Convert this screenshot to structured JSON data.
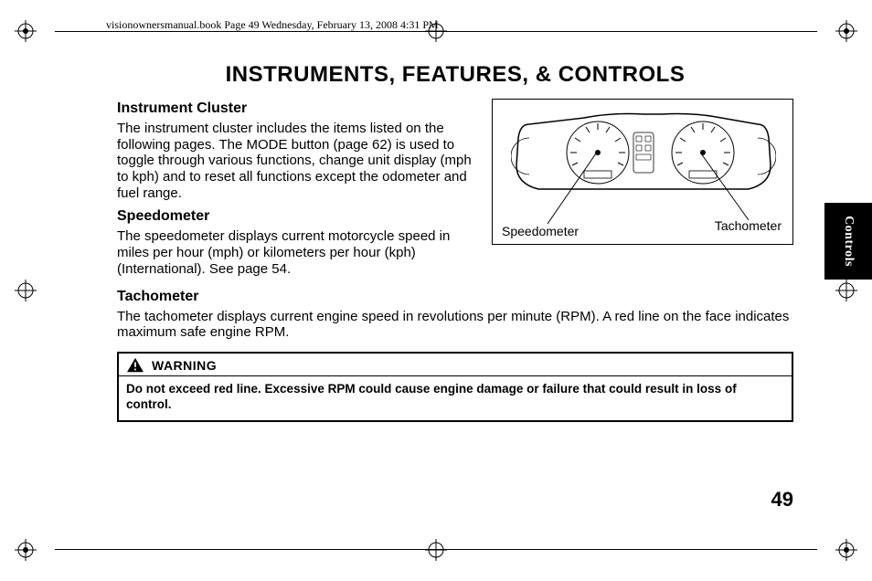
{
  "header_info": "visionownersmanual.book  Page 49  Wednesday, February 13, 2008  4:31 PM",
  "page_title": "INSTRUMENTS, FEATURES, & CONTROLS",
  "tab_label": "Controls",
  "page_number": "49",
  "sections": {
    "instrument_cluster": {
      "heading": "Instrument Cluster",
      "body": "The instrument cluster includes the items listed on the following pages. The MODE button (page 62) is used to toggle through various functions, change unit display (mph to kph) and to reset all functions except the odometer and fuel range."
    },
    "speedometer": {
      "heading": "Speedometer",
      "body": "The speedometer displays current motorcycle speed in miles per hour (mph) or kilometers per hour (kph) (International). See page 54."
    },
    "tachometer": {
      "heading": "Tachometer",
      "body": "The tachometer displays current engine speed in revolutions per minute (RPM). A red line on the face indicates maximum safe engine RPM."
    }
  },
  "figure": {
    "left_label": "Speedometer",
    "right_label": "Tachometer"
  },
  "warning": {
    "label": "WARNING",
    "body": "Do not exceed red line. Excessive RPM could cause engine damage or failure that could result in loss of control."
  }
}
